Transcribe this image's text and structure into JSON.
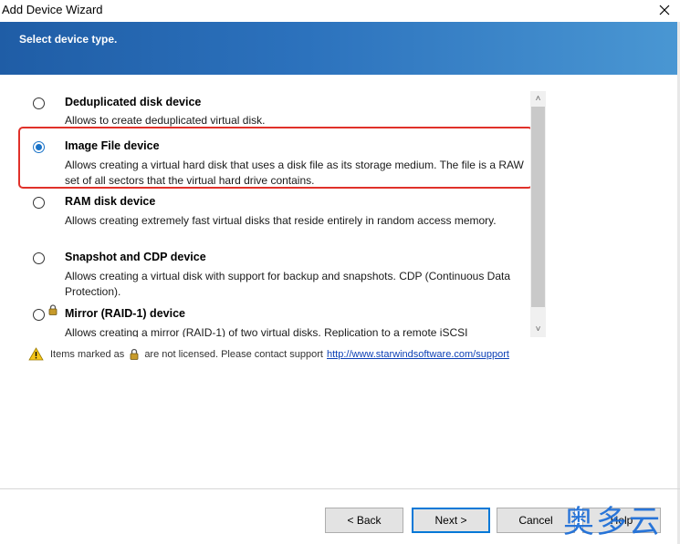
{
  "window": {
    "title": "Add Device Wizard",
    "close_glyph": "✕"
  },
  "banner": {
    "heading": "Select device type."
  },
  "device_types": [
    {
      "title": "Deduplicated disk device",
      "description": "Allows to create deduplicated virtual disk.",
      "selected": false,
      "locked": false
    },
    {
      "title": "Image File device",
      "description": "Allows creating a virtual hard disk that uses a disk file as its storage medium. The file is a RAW set of all sectors that the virtual hard drive contains.",
      "selected": true,
      "locked": false
    },
    {
      "title": "RAM disk device",
      "description": "Allows creating extremely fast virtual disks that reside entirely in random access memory.",
      "selected": false,
      "locked": false
    },
    {
      "title": "Snapshot and CDP device",
      "description": "Allows creating a virtual disk with support for backup and snapshots. CDP (Continuous Data Protection).",
      "selected": false,
      "locked": false
    },
    {
      "title": "Mirror (RAID-1) device",
      "description": "Allows creating a mirror (RAID-1) of two virtual disks. Replication to a remote iSCSI",
      "selected": false,
      "locked": true
    }
  ],
  "scrollbar": {
    "up_glyph": "˄",
    "down_glyph": "˅"
  },
  "notice": {
    "text_before": "Items marked as",
    "text_after": "are not licensed. Please contact support",
    "link": "http://www.starwindsoftware.com/support"
  },
  "buttons": {
    "back": "< Back",
    "next": "Next >",
    "cancel": "Cancel",
    "help": "Help"
  },
  "watermark": "奥多云",
  "colors": {
    "banner_start": "#1f5da6",
    "banner_end": "#4a97d3",
    "highlight": "#e0312a",
    "link": "#0b3fb5"
  },
  "icons": {
    "warning": "warning-icon",
    "lock": "lock-icon",
    "close": "close-icon"
  }
}
